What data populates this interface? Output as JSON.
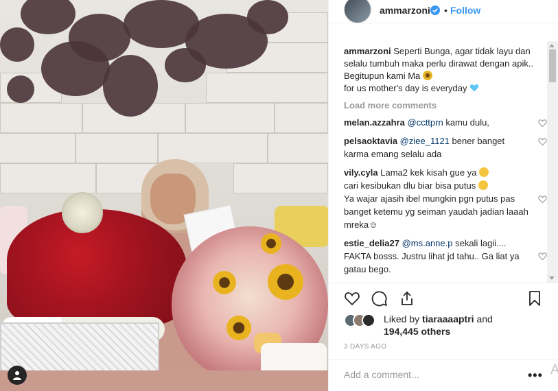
{
  "colors": {
    "accent_blue": "#3897f0",
    "mention_blue": "#003569",
    "muted_gray": "#999999",
    "text": "#262626",
    "border": "#efefef"
  },
  "post": {
    "username": "ammarzoni",
    "verified_icon": "verified-badge-icon",
    "separator": "•",
    "follow_label": "Follow"
  },
  "caption": {
    "username": "ammarzoni",
    "line1": "Seperti Bunga, agar tidak layu dan selalu tumbuh maka perlu dirawat dengan apik..",
    "line2": "Begitupun kami Ma",
    "line3": "for us mother's day is everyday"
  },
  "load_more": "Load more comments",
  "comments": [
    {
      "user": "melan.azzahra",
      "mention": "@ccttprn",
      "text": " kamu dulu,"
    },
    {
      "user": "pelsaoktavia",
      "mention": "@ziee_1121",
      "text": " bener banget karma emang selalu ada"
    },
    {
      "user": "vily.cyla",
      "mention": "",
      "text": "Lama2 kek kisah gue ya",
      "text2": "cari kesibukan dlu biar bisa putus",
      "text3": "Ya wajar ajasih ibel mungkin pgn putus pas banget ketemu yg seiman yaudah jadian laaah mreka☺"
    },
    {
      "user": "estie_delia27",
      "mention": "@ms.anne.p",
      "text": " sekali lagii....",
      "text2": "FAKTA bosss. Justru lihat jd tahu.. Ga liat ya gatau bego."
    }
  ],
  "likes": {
    "prefix": "Liked by",
    "user": "tiaraaaaptri",
    "and": "and",
    "count": "194,445 others"
  },
  "time_ago": "3 DAYS AGO",
  "add_comment_placeholder": "Add a comment...",
  "more_options": "•••",
  "edge_char": "A"
}
